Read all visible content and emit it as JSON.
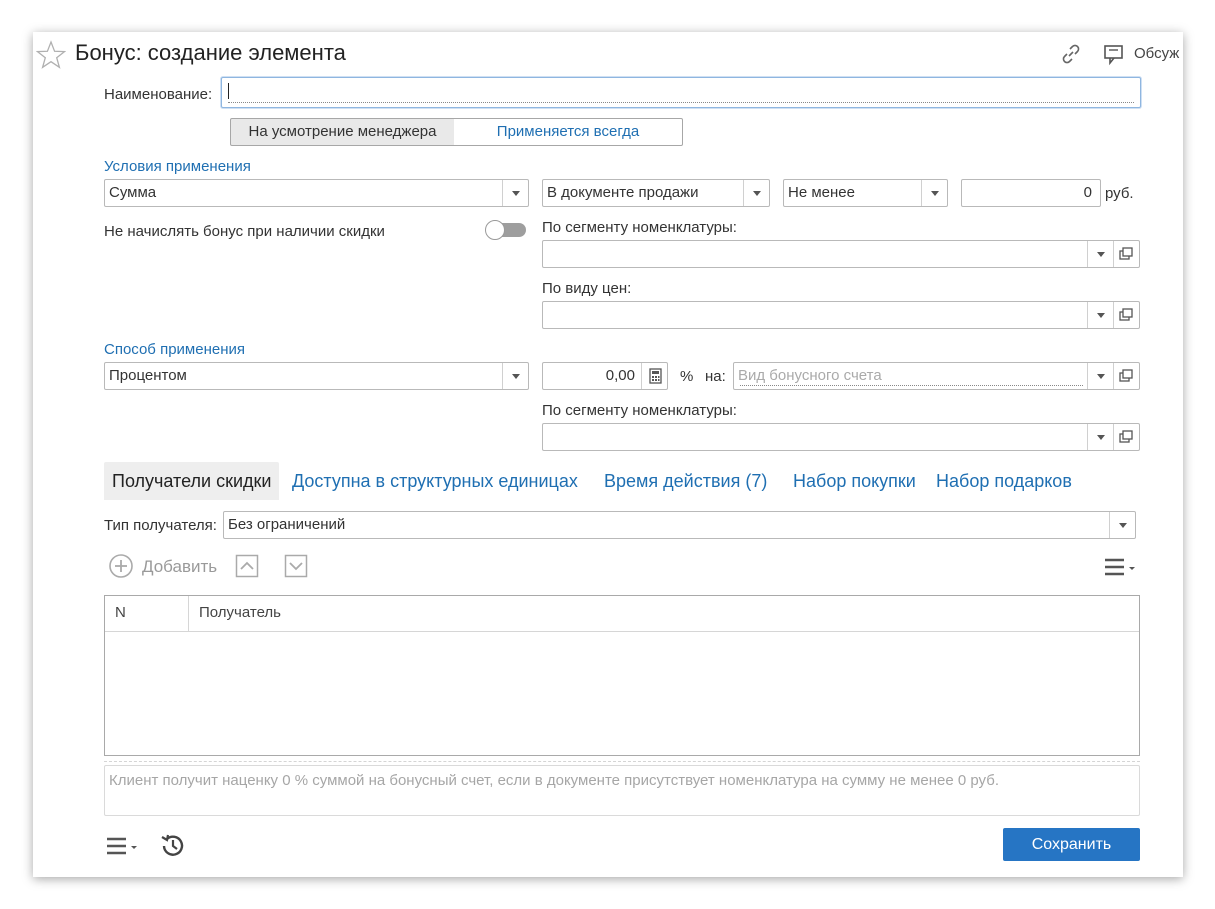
{
  "header": {
    "title": "Бонус: создание элемента",
    "discuss": "Обсуж"
  },
  "name_field": {
    "label": "Наименование:",
    "value": ""
  },
  "mode": {
    "option1": "На усмотрение менеджера",
    "option2": "Применяется всегда",
    "selected": "Применяется всегда"
  },
  "conditions": {
    "title": "Условия применения",
    "type": "Сумма",
    "where": "В документе продажи",
    "compare": "Не менее",
    "amount": "0",
    "unit": "руб.",
    "no_bonus_label": "Не начислять бонус при наличии скидки",
    "no_bonus_on": false,
    "segment_label": "По сегменту номенклатуры:",
    "segment_value": "",
    "price_type_label": "По виду цен:",
    "price_type_value": ""
  },
  "method": {
    "title": "Способ применения",
    "type": "Процентом",
    "percent": "0,00",
    "percent_sign": "%",
    "on_label": "на:",
    "account_placeholder": "Вид бонусного счета",
    "segment_label": "По сегменту номенклатуры:",
    "segment_value": ""
  },
  "tabs": [
    {
      "label": "Получатели скидки",
      "active": true
    },
    {
      "label": "Доступна в структурных единицах",
      "active": false
    },
    {
      "label": "Время действия (7)",
      "active": false
    },
    {
      "label": "Набор покупки",
      "active": false
    },
    {
      "label": "Набор подарков",
      "active": false
    }
  ],
  "recipients": {
    "type_label": "Тип получателя:",
    "type_value": "Без ограничений",
    "add_label": "Добавить",
    "columns": [
      "N",
      "Получатель"
    ],
    "rows": []
  },
  "info_text": "Клиент получит наценку 0 % суммой на бонусный счет, если в документе присутствует номенклатура на сумму не менее 0 руб.",
  "footer": {
    "save_label": "Сохранить"
  },
  "colors": {
    "accent": "#1f6fb2",
    "save_button": "#2675c4",
    "active_tab_bg": "#eeeeee"
  }
}
